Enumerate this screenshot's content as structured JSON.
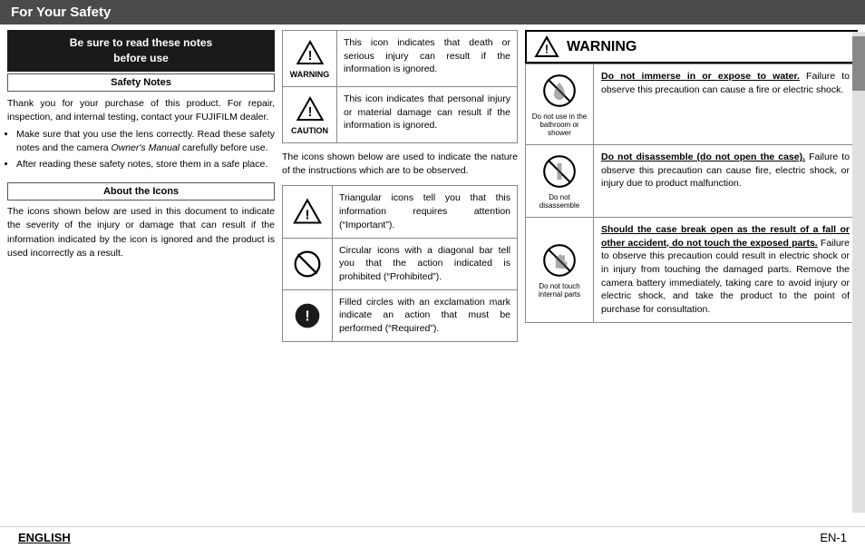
{
  "header": {
    "title": "For Your Safety"
  },
  "left": {
    "safety_header_line1": "Be sure to read these notes",
    "safety_header_line2": "before use",
    "safety_notes_label": "Safety Notes",
    "body_text": "Thank you for your purchase of this product. For repair, inspection, and internal testing, contact your FUJIFILM dealer.",
    "bullets": [
      "Make sure that you use the lens correctly. Read these safety notes and the camera Owner's Manual carefully before use.",
      "After reading these safety notes, store them in a safe place."
    ],
    "about_icons_label": "About the Icons",
    "about_icons_text": "The icons shown below are used in this document to indicate the severity of the injury or damage that can result if the information indicated by the icon is ignored and the product is used incorrectly as a result."
  },
  "middle": {
    "warning_rows": [
      {
        "label": "WARNING",
        "desc": "This icon indicates that death or serious injury can result if the information is ignored."
      },
      {
        "label": "CAUTION",
        "desc": "This icon indicates that personal injury or material damage can result if the information is ignored."
      }
    ],
    "icons_used_text": "The icons shown below are used to indicate the nature of the instructions which are to be observed.",
    "icon_examples": [
      {
        "type": "triangle",
        "desc": "Triangular icons tell you that this information requires attention (“Important”)."
      },
      {
        "type": "circle-slash",
        "desc": "Circular icons with a diagonal bar tell you that the action indicated is prohibited (“Prohibited”)."
      },
      {
        "type": "filled-circle",
        "desc": "Filled circles with an exclamation mark indicate an action that must be performed (“Required”)."
      }
    ]
  },
  "right": {
    "warning_title": "WARNING",
    "warning_items": [
      {
        "icon_label": "Do not use in the bathroom or shower",
        "desc_bold": "Do not immerse in or expose to water.",
        "desc_rest": " Failure to observe this precaution can cause a fire or electric shock."
      },
      {
        "icon_label": "Do not disassemble",
        "desc_bold": "Do not disassemble (do not open the case).",
        "desc_rest": " Failure to observe this precaution can cause fire, electric shock, or injury due to product malfunction."
      },
      {
        "icon_label": "Do not touch internal parts",
        "desc_bold": "Should the case break open as the result of a fall or other accident, do not touch the exposed parts.",
        "desc_rest": " Failure to observe this precaution could result in electric shock or in injury from touching the damaged parts. Remove the camera battery immediately, taking care to avoid injury or electric shock, and take the product to the point of purchase for consultation."
      }
    ]
  },
  "footer": {
    "language": "ENGLISH",
    "page": "EN-1"
  }
}
